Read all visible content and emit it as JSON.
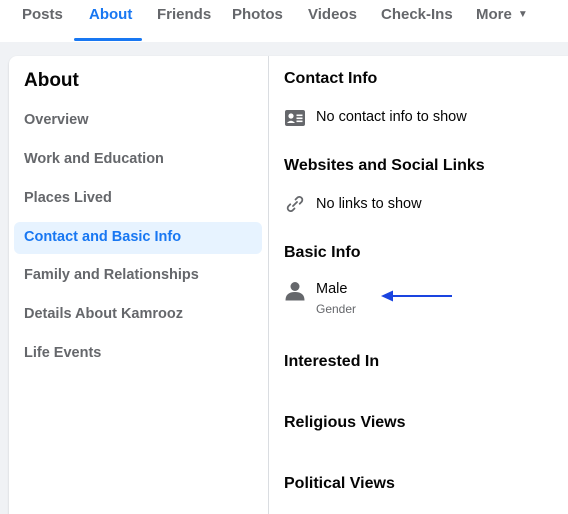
{
  "tabs": [
    {
      "label": "Posts"
    },
    {
      "label": "About"
    },
    {
      "label": "Friends"
    },
    {
      "label": "Photos"
    },
    {
      "label": "Videos"
    },
    {
      "label": "Check-Ins"
    },
    {
      "label": "More"
    }
  ],
  "active_tab": "About",
  "sidebar": {
    "title": "About",
    "items": [
      {
        "label": "Overview"
      },
      {
        "label": "Work and Education"
      },
      {
        "label": "Places Lived"
      },
      {
        "label": "Contact and Basic Info"
      },
      {
        "label": "Family and Relationships"
      },
      {
        "label": "Details About Kamrooz"
      },
      {
        "label": "Life Events"
      }
    ],
    "active_item": "Contact and Basic Info"
  },
  "main": {
    "contact_info": {
      "title": "Contact Info",
      "empty_text": "No contact info to show",
      "icon": "contact-card-icon"
    },
    "websites": {
      "title": "Websites and Social Links",
      "empty_text": "No links to show",
      "icon": "link-icon"
    },
    "basic_info": {
      "title": "Basic Info",
      "value": "Male",
      "value_label": "Gender",
      "icon": "person-icon"
    },
    "interested_in": {
      "title": "Interested In"
    },
    "religious_views": {
      "title": "Religious Views"
    },
    "political_views": {
      "title": "Political Views"
    }
  },
  "annotation": {
    "type": "arrow",
    "color": "#1a44e0"
  },
  "colors": {
    "accent": "#1877f2",
    "active_nav_bg": "#e7f3ff",
    "muted_text": "#65676b",
    "background": "#f0f2f5"
  }
}
